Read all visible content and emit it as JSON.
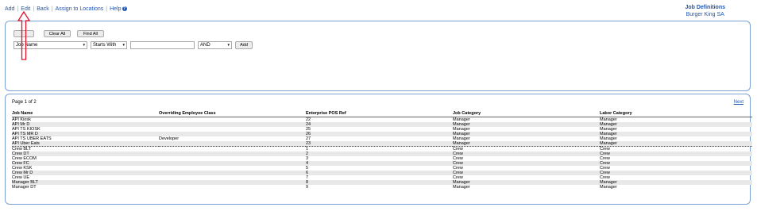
{
  "nav": {
    "add": "Add",
    "edit": "Edit",
    "back": "Back",
    "assign": "Assign to Locations",
    "help": "Help",
    "help_icon": "?"
  },
  "header": {
    "title": "Job Definitions",
    "subtitle": "Burger King SA"
  },
  "filter": {
    "clear_all": "Clear All",
    "find_all": "Find All",
    "field": "Job Name",
    "operator": "Starts With",
    "value": "",
    "conjunction": "AND",
    "add": "Add"
  },
  "results": {
    "page_label": "Page 1 of 2",
    "next": "Next",
    "columns": [
      "Job Name",
      "Overriding Employee Class",
      "Enterprise POS Ref",
      "Job Category",
      "Labor Category"
    ],
    "rows": [
      [
        "API Kiosk",
        "",
        "22",
        "Manager",
        "Manager"
      ],
      [
        "API Mr D",
        "",
        "24",
        "Manager",
        "Manager"
      ],
      [
        "API TS KIOSK",
        "",
        "25",
        "Manager",
        "Manager"
      ],
      [
        "API TS MR D",
        "",
        "26",
        "Manager",
        "Manager"
      ],
      [
        "API TS UBER EATS",
        "Developer",
        "27",
        "Manager",
        "Manager"
      ],
      [
        "API Uber Eats",
        "",
        "23",
        "Manager",
        "Manager"
      ],
      [
        "Crew BLT",
        "",
        "1",
        "Crew",
        "Crew"
      ],
      [
        "Crew DT",
        "",
        "2",
        "Crew",
        "Crew"
      ],
      [
        "Crew ECOM",
        "",
        "3",
        "Crew",
        "Crew"
      ],
      [
        "Crew FC",
        "",
        "4",
        "Crew",
        "Crew"
      ],
      [
        "Crew KSK",
        "",
        "5",
        "Crew",
        "Crew"
      ],
      [
        "Crew Mr D",
        "",
        "6",
        "Crew",
        "Crew"
      ],
      [
        "Crew UE",
        "",
        "7",
        "Crew",
        "Crew"
      ],
      [
        "Manager BLT",
        "",
        "8",
        "Manager",
        "Manager"
      ],
      [
        "Manager DT",
        "",
        "9",
        "Manager",
        "Manager"
      ]
    ]
  },
  "colors": {
    "link": "#1f57b5",
    "panel_border": "#7aa0d6",
    "annotation": "#e0102a"
  }
}
